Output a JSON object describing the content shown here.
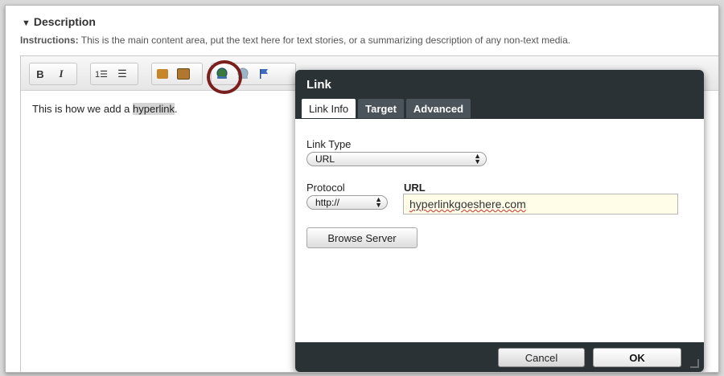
{
  "section": {
    "title": "Description",
    "instructions_label": "Instructions:",
    "instructions_text": "This is the main content area, put the text here for text stories, or a summarizing description of any non-text media."
  },
  "toolbar": {
    "bold": "B",
    "italic": "I",
    "numbered_list": "1☰",
    "bullet_list": "☰"
  },
  "editor": {
    "text_before": "This is how we add a ",
    "text_link": "hyperlink",
    "text_after": "."
  },
  "dialog": {
    "title": "Link",
    "tabs": [
      "Link Info",
      "Target",
      "Advanced"
    ],
    "link_type_label": "Link Type",
    "link_type_value": "URL",
    "protocol_label": "Protocol",
    "protocol_value": "http://",
    "url_label": "URL",
    "url_value": "hyperlinkgoeshere.com",
    "browse_label": "Browse Server",
    "cancel_label": "Cancel",
    "ok_label": "OK"
  },
  "colors": {
    "dialog_bg": "#2b3236",
    "highlight_ring": "#7a1e1e",
    "url_field_bg": "#fffde8"
  }
}
